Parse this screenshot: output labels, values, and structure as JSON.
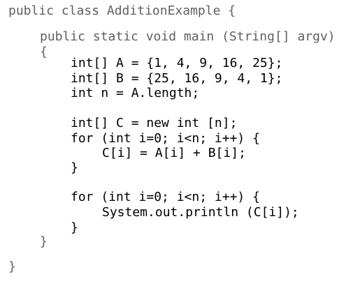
{
  "code": {
    "lines": [
      "public class AdditionExample {",
      "public static void main (String[] argv)",
      "{",
      "int[] A = {1, 4, 9, 16, 25};",
      "int[] B = {25, 16, 9, 4, 1};",
      "int n = A.length;",
      "int[] C = new int [n];",
      "for (int i=0; i<n; i++) {",
      "C[i] = A[i] + B[i];",
      "}",
      "for (int i=0; i<n; i++) {",
      "System.out.println (C[i]);",
      "}",
      "}",
      "}"
    ]
  }
}
